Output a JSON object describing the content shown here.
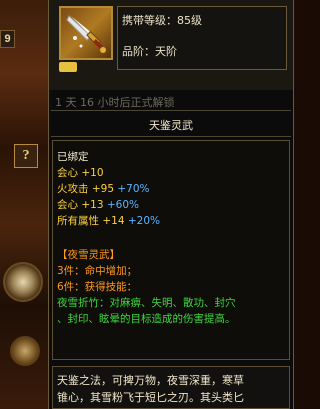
{
  "scene": {
    "number": "9",
    "button_glyph": "?"
  },
  "item": {
    "carry_level": "携带等级：85级",
    "quality": "品阶：天阶",
    "unlock_timer": "1 天 16 小时后正式解锁",
    "name": "天鉴灵武",
    "bound": "已绑定",
    "stats": [
      {
        "label": "会心",
        "value": "+10"
      },
      {
        "label": "火攻击",
        "value": "+95",
        "extra": "+70%"
      },
      {
        "label": "会心",
        "value": "+13",
        "extra": "+60%"
      },
      {
        "label": "所有属性",
        "value": "+14",
        "extra": "+20%"
      }
    ],
    "set_title": "【夜雪灵武】",
    "set_3": "3件：命中增加；",
    "set_6": "6件：获得技能：",
    "skill_line1": "夜雪折竹：对麻痹、失明、散功、封穴",
    "skill_line2": "、封印、眩晕的目标造成的伤害提高。",
    "desc_line1": "天鉴之法，可捭万物，夜雪深重，寒草",
    "desc_line2": "锥心，其雪粉飞于短匕之刃。其头类匕"
  },
  "colors": {
    "gold": "#ffd23a",
    "blue": "#5ab4ff",
    "orange": "#ff9a1a",
    "green": "#3ed83e"
  },
  "icons": {
    "item": "dagger-icon",
    "badge": "lock-badge-icon",
    "scene_button": "help-button-icon"
  }
}
